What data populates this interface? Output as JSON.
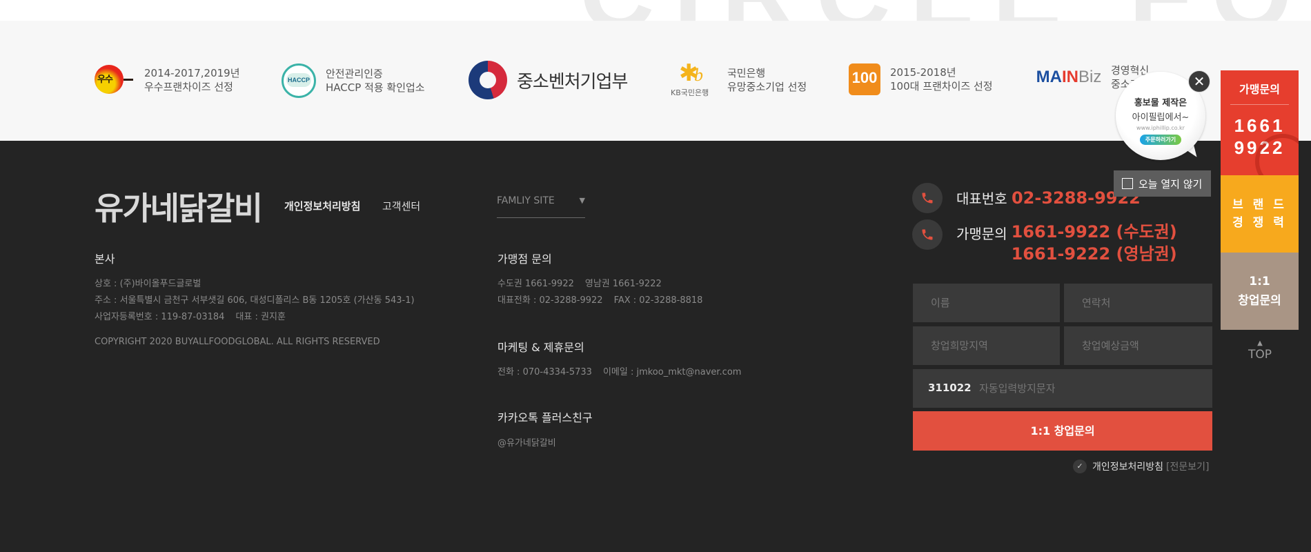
{
  "top_banner": {
    "watermark_text": "CIRCLE FOOD"
  },
  "certifications": [
    {
      "icon": "best-franchise-logo-icon",
      "line1": "2014-2017,2019년",
      "line2": "우수프랜차이즈 선정"
    },
    {
      "icon": "haccp-logo-icon",
      "badge_text": "HACCP",
      "line1": "안전관리인증",
      "line2": "HACCP 적용 확인업소"
    },
    {
      "icon": "ministry-sme-logo-icon",
      "label": "중소벤처기업부"
    },
    {
      "icon": "kb-bank-logo-icon",
      "badge_text": "KB국민은행",
      "line1": "국민은행",
      "line2": "유망중소기업 선정"
    },
    {
      "icon": "top100-logo-icon",
      "badge_text": "100",
      "line1": "2015-2018년",
      "line2": "100대 프랜차이즈 선정"
    },
    {
      "icon": "mainbiz-logo-icon",
      "badge_main": "MA",
      "badge_in": "IN",
      "badge_biz": "Biz",
      "line1": "경영혁신",
      "line2": "중소기업"
    }
  ],
  "footer": {
    "brand": "유가네닭갈비",
    "links": {
      "privacy": "개인정보처리방침",
      "support": "고객센터"
    },
    "family_site": {
      "label": "FAMLIY SITE",
      "arrow": "▼"
    },
    "hq": {
      "title": "본사",
      "company": "상호 : (주)바이올푸드글로벌",
      "address": "주소 : 서울특별시 금천구 서부샛길 606, 대성디폴리스 B동 1205호 (가산동 543-1)",
      "bizno": "사업자등록번호 : 119-87-03184",
      "ceo": "대표 : 권지훈",
      "copyright": "COPYRIGHT 2020 BUYALLFOODGLOBAL. ALL RIGHTS RESERVED"
    },
    "franchise_inquiry": {
      "title": "가맹점 문의",
      "capital": "수도권 1661-9922",
      "yeongnam": "영남권 1661-9222",
      "main_tel": "대표전화 : 02-3288-9922",
      "fax": "FAX : 02-3288-8818"
    },
    "marketing": {
      "title": "마케팅 & 제휴문의",
      "tel": "전화 : 070-4334-5733",
      "email": "이메일 : jmkoo_mkt@naver.com"
    },
    "kakao": {
      "title": "카카오톡 플러스친구",
      "id": "@유가네닭갈비"
    }
  },
  "contact": {
    "main_label": "대표번호",
    "main_number": "02-3288-9922",
    "franchise_label": "가맹문의",
    "franchise_number_1": "1661-9922 (수도권)",
    "franchise_number_2": "1661-9222 (영남권)",
    "form": {
      "name_placeholder": "이름",
      "phone_placeholder": "연락처",
      "region_placeholder": "창업희망지역",
      "budget_placeholder": "창업예상금액",
      "captcha_code": "311022",
      "captcha_placeholder": "자동입력방지문자",
      "submit_label": "1:1 창업문의",
      "privacy_label": "개인정보처리방침",
      "privacy_full": "[전문보기]",
      "check_glyph": "✓"
    }
  },
  "quick_menu": {
    "franchise_title": "가맹문의",
    "franchise_number_1": "1661",
    "franchise_number_2": "9922",
    "brand_power_1": "브 랜 드",
    "brand_power_2": "경 쟁 력",
    "consult_1": "1:1",
    "consult_2": "창업문의",
    "top_label": "TOP",
    "top_arrow": "▲"
  },
  "popup": {
    "line1": "홍보물 제작은",
    "line2": "아이필립에서~",
    "line3": "www.iphillip.co.kr",
    "button": "주문하러가기",
    "close_glyph": "✕",
    "no_show_today": "오늘 열지 않기"
  },
  "colors": {
    "accent_red": "#e2503f",
    "quick_orange": "#f7a91d",
    "quick_tan": "#a99585",
    "footer_bg": "#242424"
  }
}
